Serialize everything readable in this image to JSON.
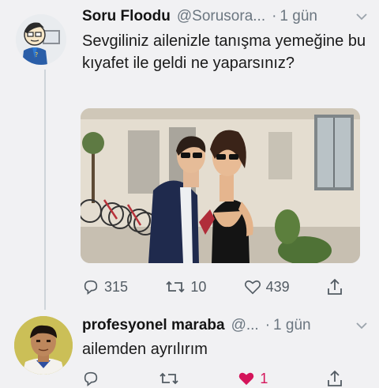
{
  "tweet1": {
    "display_name": "Soru Floodu",
    "handle": "@Sorusora...",
    "separator": "·",
    "time": "1 gün",
    "text": "Sevgiliniz ailenizle tanışma yemeğine bu kıyafet ile geldi ne yaparsınız?",
    "replies": "315",
    "retweets": "10",
    "likes": "439"
  },
  "tweet2": {
    "display_name": "profesyonel maraba",
    "handle": "@...",
    "separator": "·",
    "time": "1 gün",
    "text": "ailemden ayrılırım",
    "likes": "1"
  },
  "colors": {
    "background": "#f1f1f3",
    "text": "#1c1c1c",
    "muted": "#6b7680",
    "like_active": "#d4145a"
  },
  "icons": [
    "reply-icon",
    "retweet-icon",
    "like-icon",
    "share-icon",
    "chevron-down-icon"
  ]
}
